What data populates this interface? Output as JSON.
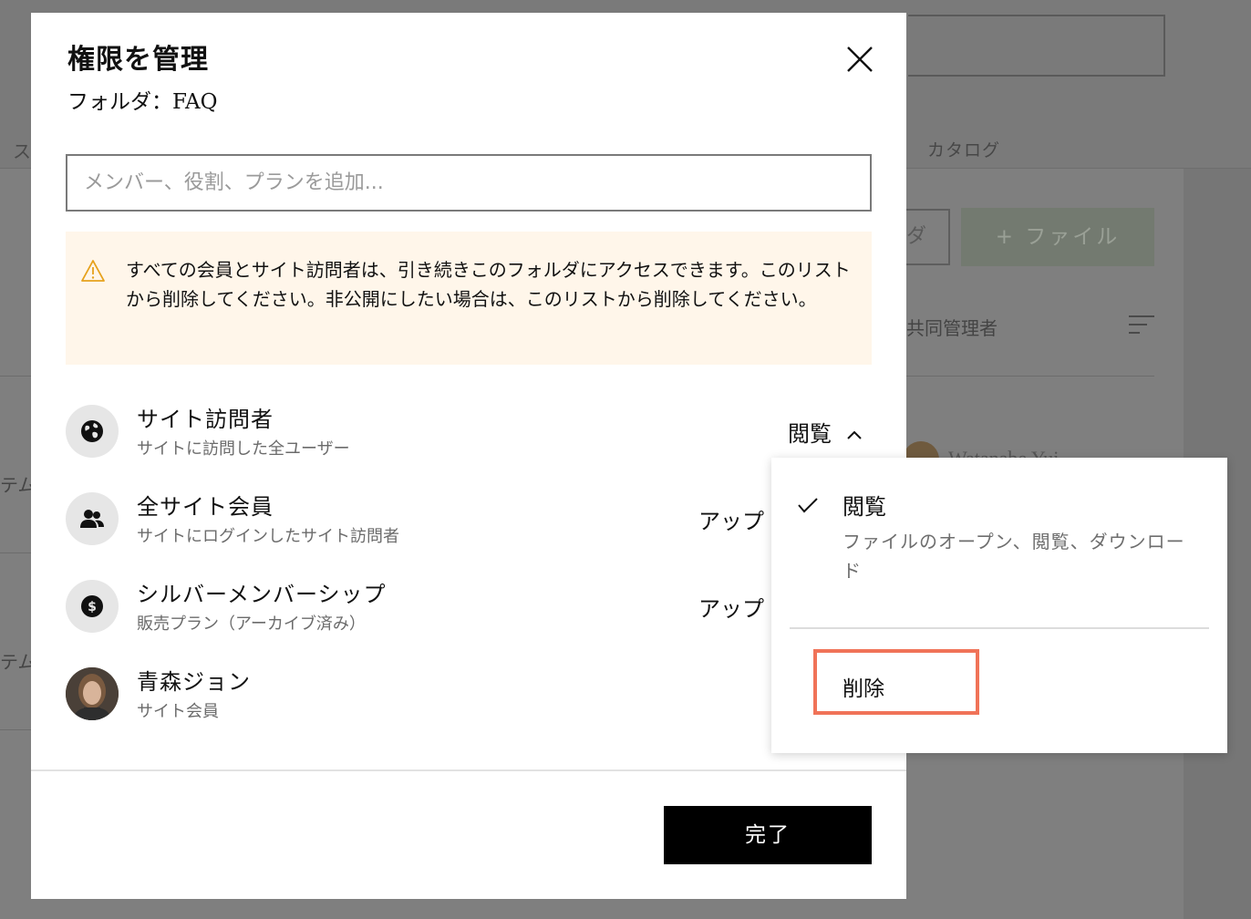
{
  "background": {
    "tab_left": "ス",
    "tab_catalog": "カタログ",
    "folder_button_label": "ダ",
    "file_button_label": "+ ファイル",
    "owner_label": "共同管理者",
    "item_left_1": "テム",
    "item_left_2": "テム",
    "user_name": "Watanabe Yui"
  },
  "modal": {
    "title": "権限を管理",
    "subtitle": "フォルダ：FAQ",
    "search_placeholder": "メンバー、役割、プランを追加...",
    "notice": "すべての会員とサイト訪問者は、引き続きこのフォルダにアクセスできます。このリストから削除してください。非公開にしたい場合は、このリストから削除してください。",
    "rows": [
      {
        "name": "サイト訪問者",
        "sub": "サイトに訪問した全ユーザー",
        "permission": "閲覧",
        "icon": "globe-icon"
      },
      {
        "name": "全サイト会員",
        "sub": "サイトにログインしたサイト訪問者",
        "permission": "アップ",
        "icon": "people-icon"
      },
      {
        "name": "シルバーメンバーシップ",
        "sub": "販売プラン（アーカイブ済み）",
        "permission": "アップ",
        "icon": "dollar-icon"
      },
      {
        "name": "青森ジョン",
        "sub": "サイト会員",
        "permission": "",
        "icon": "avatar"
      }
    ],
    "done_label": "完了"
  },
  "dropdown": {
    "option_label": "閲覧",
    "option_desc": "ファイルのオープン、閲覧、ダウンロード",
    "delete_label": "削除"
  },
  "colors": {
    "notice_bg": "#fff6ea",
    "highlight": "#f07358",
    "done_bg": "#000000"
  }
}
